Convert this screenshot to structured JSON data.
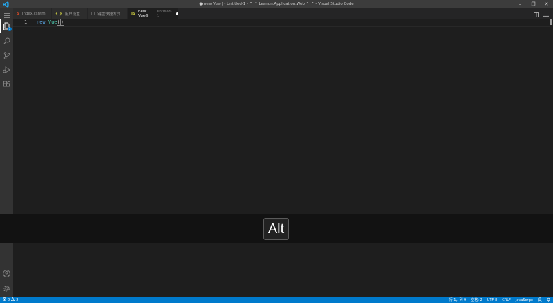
{
  "window": {
    "title": "● new Vue() - Untitled-1 - ^_^ Leanun.Application.Web ^_^ - Visual Studio Code",
    "controls": {
      "minimize": "–",
      "restore": "❐",
      "close": "✕"
    }
  },
  "activity_bar": {
    "items": [
      {
        "name": "explorer-icon",
        "badge": "1"
      },
      {
        "name": "search-icon"
      },
      {
        "name": "source-control-icon"
      },
      {
        "name": "run-debug-icon"
      },
      {
        "name": "extensions-icon"
      }
    ],
    "bottom": [
      {
        "name": "account-icon"
      },
      {
        "name": "manage-gear-icon"
      }
    ]
  },
  "tabs": [
    {
      "icon": "5",
      "icon_color": "#e44d26",
      "label": "Index.cshtml",
      "active": false
    },
    {
      "icon": "{ }",
      "icon_color": "#cbcb41",
      "label": "用户设置",
      "active": false
    },
    {
      "icon": "▢",
      "icon_color": "#c5c5c5",
      "label": "键盘快捷方式",
      "active": false
    },
    {
      "icon": "JS",
      "icon_color": "#cbcb41",
      "label": "new Vue()",
      "sub": "Untitled-1",
      "active": true,
      "dirty": true
    }
  ],
  "editor": {
    "line_number": "1",
    "code": {
      "keyword": "new",
      "space": " ",
      "class_name": "Vue",
      "open_paren": "(",
      "close_paren": ")"
    }
  },
  "key_overlay": {
    "key": "Alt"
  },
  "status_bar": {
    "errors": "0",
    "warnings": "2",
    "position": "行 1，列 9",
    "indent": "空格: 2",
    "encoding": "UTF-8",
    "eol": "CRLF",
    "language": "JavaScript"
  },
  "colors": {
    "statusbar": "#007acc",
    "titlebar": "#3c3c3c",
    "activitybar": "#333333",
    "editor": "#1e1e1e",
    "keyword": "#569cd6",
    "class": "#4ec9b0"
  }
}
